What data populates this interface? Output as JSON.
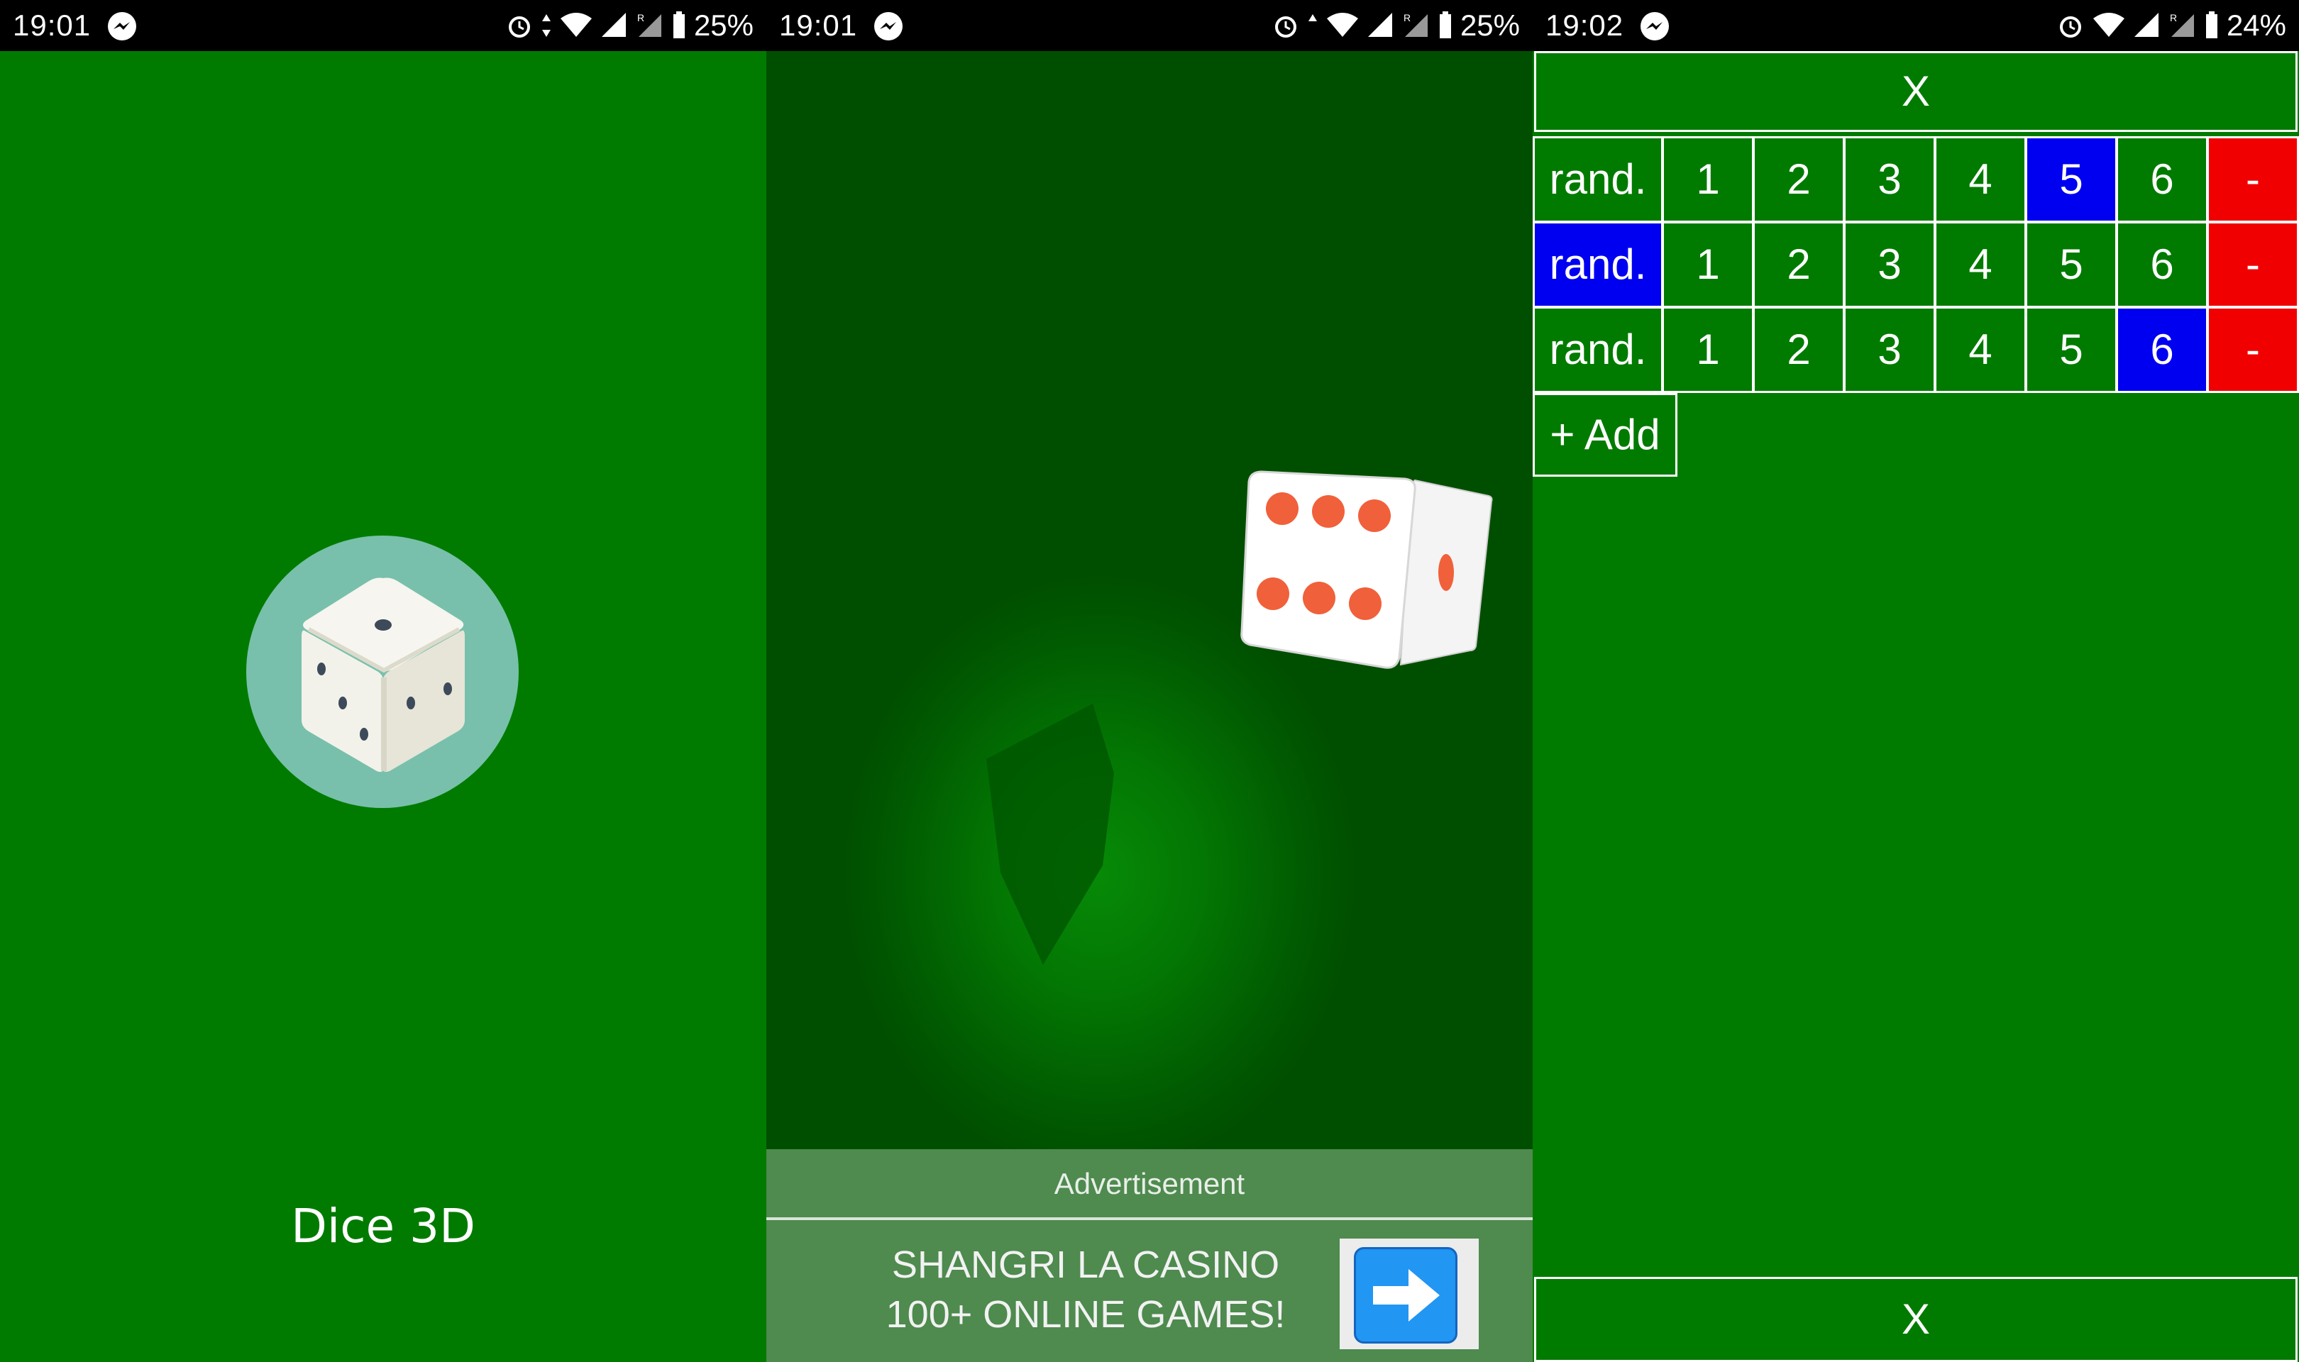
{
  "screens": [
    {
      "status": {
        "time": "19:01",
        "battery": "25%"
      },
      "app_name": "Dice 3D"
    },
    {
      "status": {
        "time": "19:01",
        "battery": "25%"
      },
      "die_faces": {
        "front": 6,
        "side": 1
      },
      "ad": {
        "header": "Advertisement",
        "line1": "SHANGRI LA CASINO",
        "line2": "100+ ONLINE GAMES!",
        "button_icon": "right-arrow-icon"
      }
    },
    {
      "status": {
        "time": "19:02",
        "battery": "24%"
      },
      "close_top": "X",
      "close_bottom": "X",
      "rows": [
        {
          "rand": "rand.",
          "values": [
            "1",
            "2",
            "3",
            "4",
            "5",
            "6"
          ],
          "delete": "-",
          "selected": "5"
        },
        {
          "rand": "rand.",
          "values": [
            "1",
            "2",
            "3",
            "4",
            "5",
            "6"
          ],
          "delete": "-",
          "selected": "rand."
        },
        {
          "rand": "rand.",
          "values": [
            "1",
            "2",
            "3",
            "4",
            "5",
            "6"
          ],
          "delete": "-",
          "selected": "6"
        }
      ],
      "add_label": "+ Add"
    }
  ],
  "colors": {
    "table_green": "#007b00",
    "selected_blue": "#0000f0",
    "delete_red": "#f00000",
    "ad_green": "#4f8a4f",
    "logo_teal": "#78c0ab",
    "pip_orange": "#f0603a"
  }
}
